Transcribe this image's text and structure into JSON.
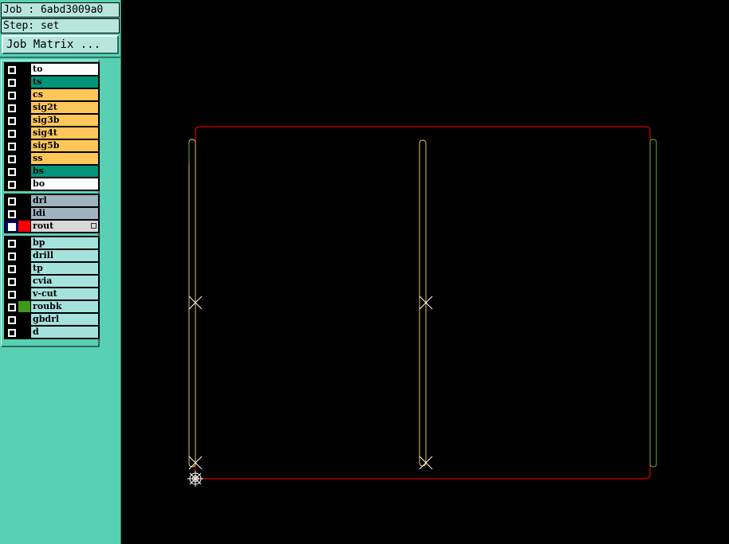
{
  "header": {
    "job_label": "Job : 6abd3009a0",
    "step_label": "Step: set",
    "matrix_button": "Job Matrix ..."
  },
  "layers": {
    "board": [
      {
        "name": "to",
        "color": "#ffffff",
        "dark_text": false,
        "active": false
      },
      {
        "name": "ts",
        "color": "#00957a",
        "dark_text": false,
        "active": false
      },
      {
        "name": "cs",
        "color": "#ffc75a",
        "dark_text": false,
        "active": false
      },
      {
        "name": "sig2t",
        "color": "#ffc75a",
        "dark_text": false,
        "active": false
      },
      {
        "name": "sig3b",
        "color": "#ffc75a",
        "dark_text": false,
        "active": false
      },
      {
        "name": "sig4t",
        "color": "#ffc75a",
        "dark_text": false,
        "active": false
      },
      {
        "name": "sig5b",
        "color": "#ffc75a",
        "dark_text": false,
        "active": false
      },
      {
        "name": "ss",
        "color": "#ffc75a",
        "dark_text": false,
        "active": false
      },
      {
        "name": "bs",
        "color": "#00957a",
        "dark_text": false,
        "active": false
      },
      {
        "name": "bo",
        "color": "#ffffff",
        "dark_text": false,
        "active": false
      }
    ],
    "drill": [
      {
        "name": "drl",
        "color": "#9fb4c0",
        "dark_text": false,
        "active": false
      },
      {
        "name": "ldi",
        "color": "#9fb4c0",
        "dark_text": false,
        "active": false
      },
      {
        "name": "rout",
        "color": "#d9d9d9",
        "dark_text": false,
        "active": true,
        "swatch": "#ff0000"
      }
    ],
    "misc": [
      {
        "name": "bp",
        "color": "#a6e2dd",
        "dark_text": false,
        "active": false
      },
      {
        "name": "drill",
        "color": "#a6e2dd",
        "dark_text": false,
        "active": false
      },
      {
        "name": "tp",
        "color": "#a6e2dd",
        "dark_text": false,
        "active": false
      },
      {
        "name": "cvia",
        "color": "#a6e2dd",
        "dark_text": false,
        "active": false
      },
      {
        "name": "v-cut",
        "color": "#a6e2dd",
        "dark_text": false,
        "active": false
      },
      {
        "name": "roubk",
        "color": "#a6e2dd",
        "dark_text": false,
        "active": false,
        "swatch": "#3c9a1a"
      },
      {
        "name": "gbdrl",
        "color": "#a6e2dd",
        "dark_text": false,
        "active": false
      },
      {
        "name": "d",
        "color": "#a6e2dd",
        "dark_text": false,
        "active": false
      }
    ]
  },
  "colors": {
    "sidebar_bg": "#58d0b4",
    "canvas_bg": "#000000",
    "rout_outline": "#ff0000",
    "slot_yellow": "#e8c060",
    "slot_green": "#6aaa40",
    "marker": "#ffffff"
  }
}
